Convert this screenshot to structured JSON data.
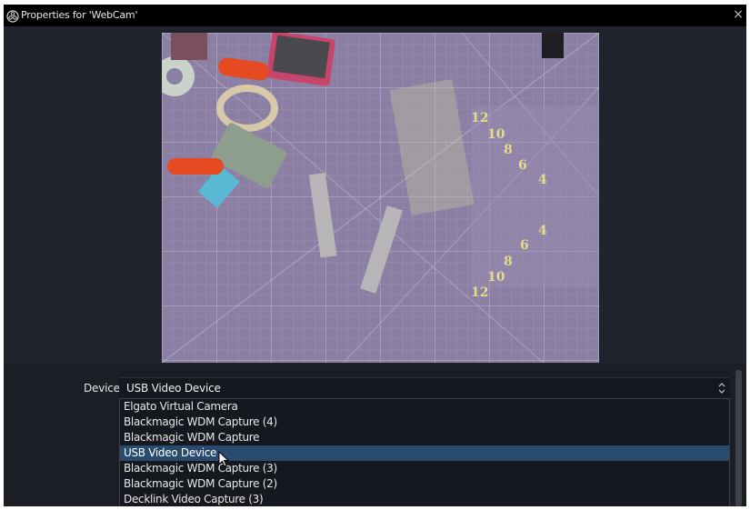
{
  "window": {
    "title": "Properties for 'WebCam'",
    "close_glyph": "×"
  },
  "icons": {
    "app": "obs-logo-icon",
    "close": "close-icon",
    "select_arrows": "select-arrows-icon",
    "cursor": "mouse-cursor-icon"
  },
  "preview": {
    "mat_numbers_left": [
      "12",
      "10",
      "8",
      "6",
      "4"
    ],
    "mat_numbers_lower": [
      "4",
      "6",
      "8",
      "10",
      "12"
    ]
  },
  "properties": {
    "device_label": "Device",
    "device_value": "USB Video Device",
    "arrows_glyph": "⌃⌄",
    "options": [
      "Elgato Virtual Camera",
      "Blackmagic WDM Capture (4)",
      "Blackmagic WDM Capture",
      "USB Video Device",
      "Blackmagic WDM Capture (3)",
      "Blackmagic WDM Capture (2)",
      "Decklink Video Capture (3)"
    ],
    "selected_index": 3
  },
  "colors": {
    "window_bg": "#1f232b",
    "titlebar_bg": "#000000",
    "selection": "#284b6e",
    "mat": "#8a7ea3"
  }
}
